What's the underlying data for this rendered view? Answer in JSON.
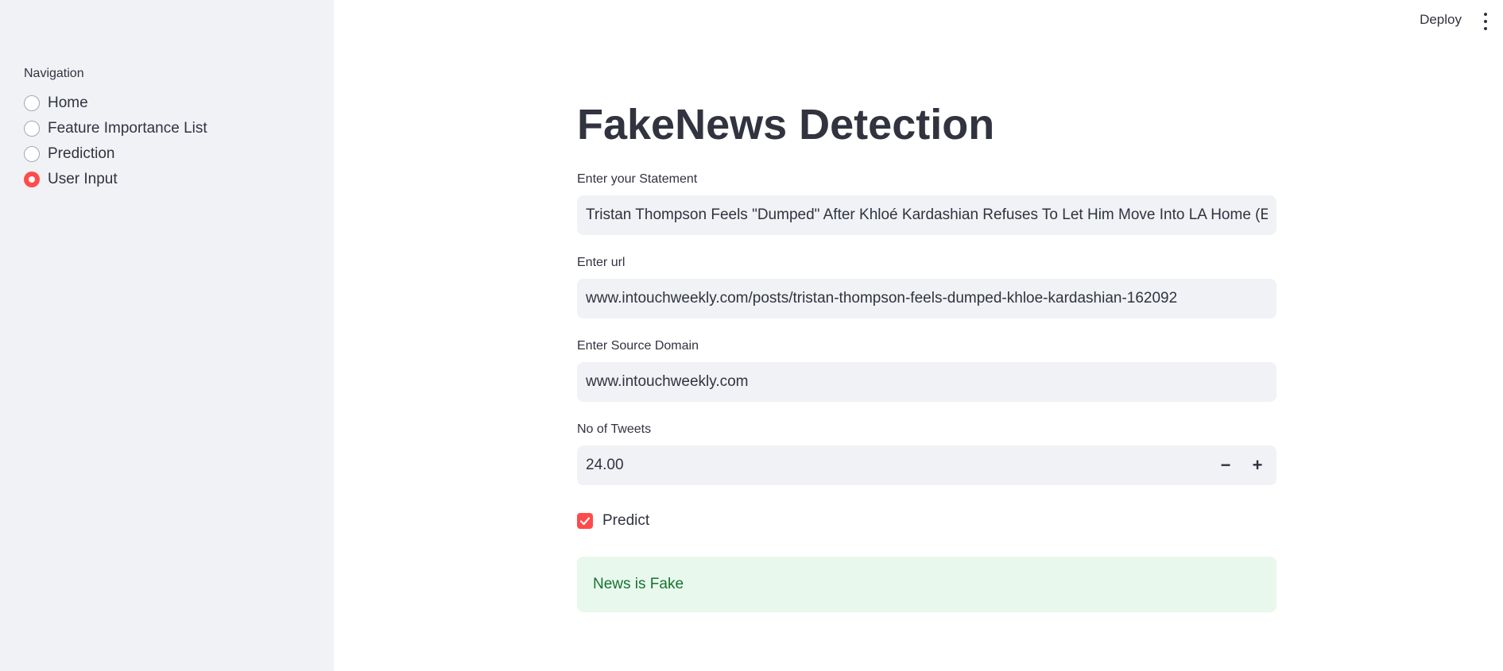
{
  "header": {
    "deploy_label": "Deploy",
    "menu_icon": "more-vertical-icon"
  },
  "sidebar": {
    "nav_label": "Navigation",
    "items": [
      {
        "label": "Home",
        "selected": false
      },
      {
        "label": "Feature Importance List",
        "selected": false
      },
      {
        "label": "Prediction",
        "selected": false
      },
      {
        "label": "User Input",
        "selected": true
      }
    ]
  },
  "main": {
    "title": "FakeNews Detection",
    "statement": {
      "label": "Enter your Statement",
      "value": "Tristan Thompson Feels \"Dumped\" After Khloé Kardashian Refuses To Let Him Move Into LA Home (EXCL"
    },
    "url": {
      "label": "Enter url",
      "value": "www.intouchweekly.com/posts/tristan-thompson-feels-dumped-khloe-kardashian-162092"
    },
    "source_domain": {
      "label": "Enter Source Domain",
      "value": "www.intouchweekly.com"
    },
    "tweets": {
      "label": "No of Tweets",
      "value": "24.00",
      "minus": "−",
      "plus": "+"
    },
    "predict": {
      "label": "Predict",
      "checked": true
    },
    "result": "News is Fake"
  },
  "colors": {
    "accent": "#ff4b4b",
    "sidebar_bg": "#f0f2f6",
    "success_bg": "#e8f8ec",
    "success_text": "#177233"
  }
}
